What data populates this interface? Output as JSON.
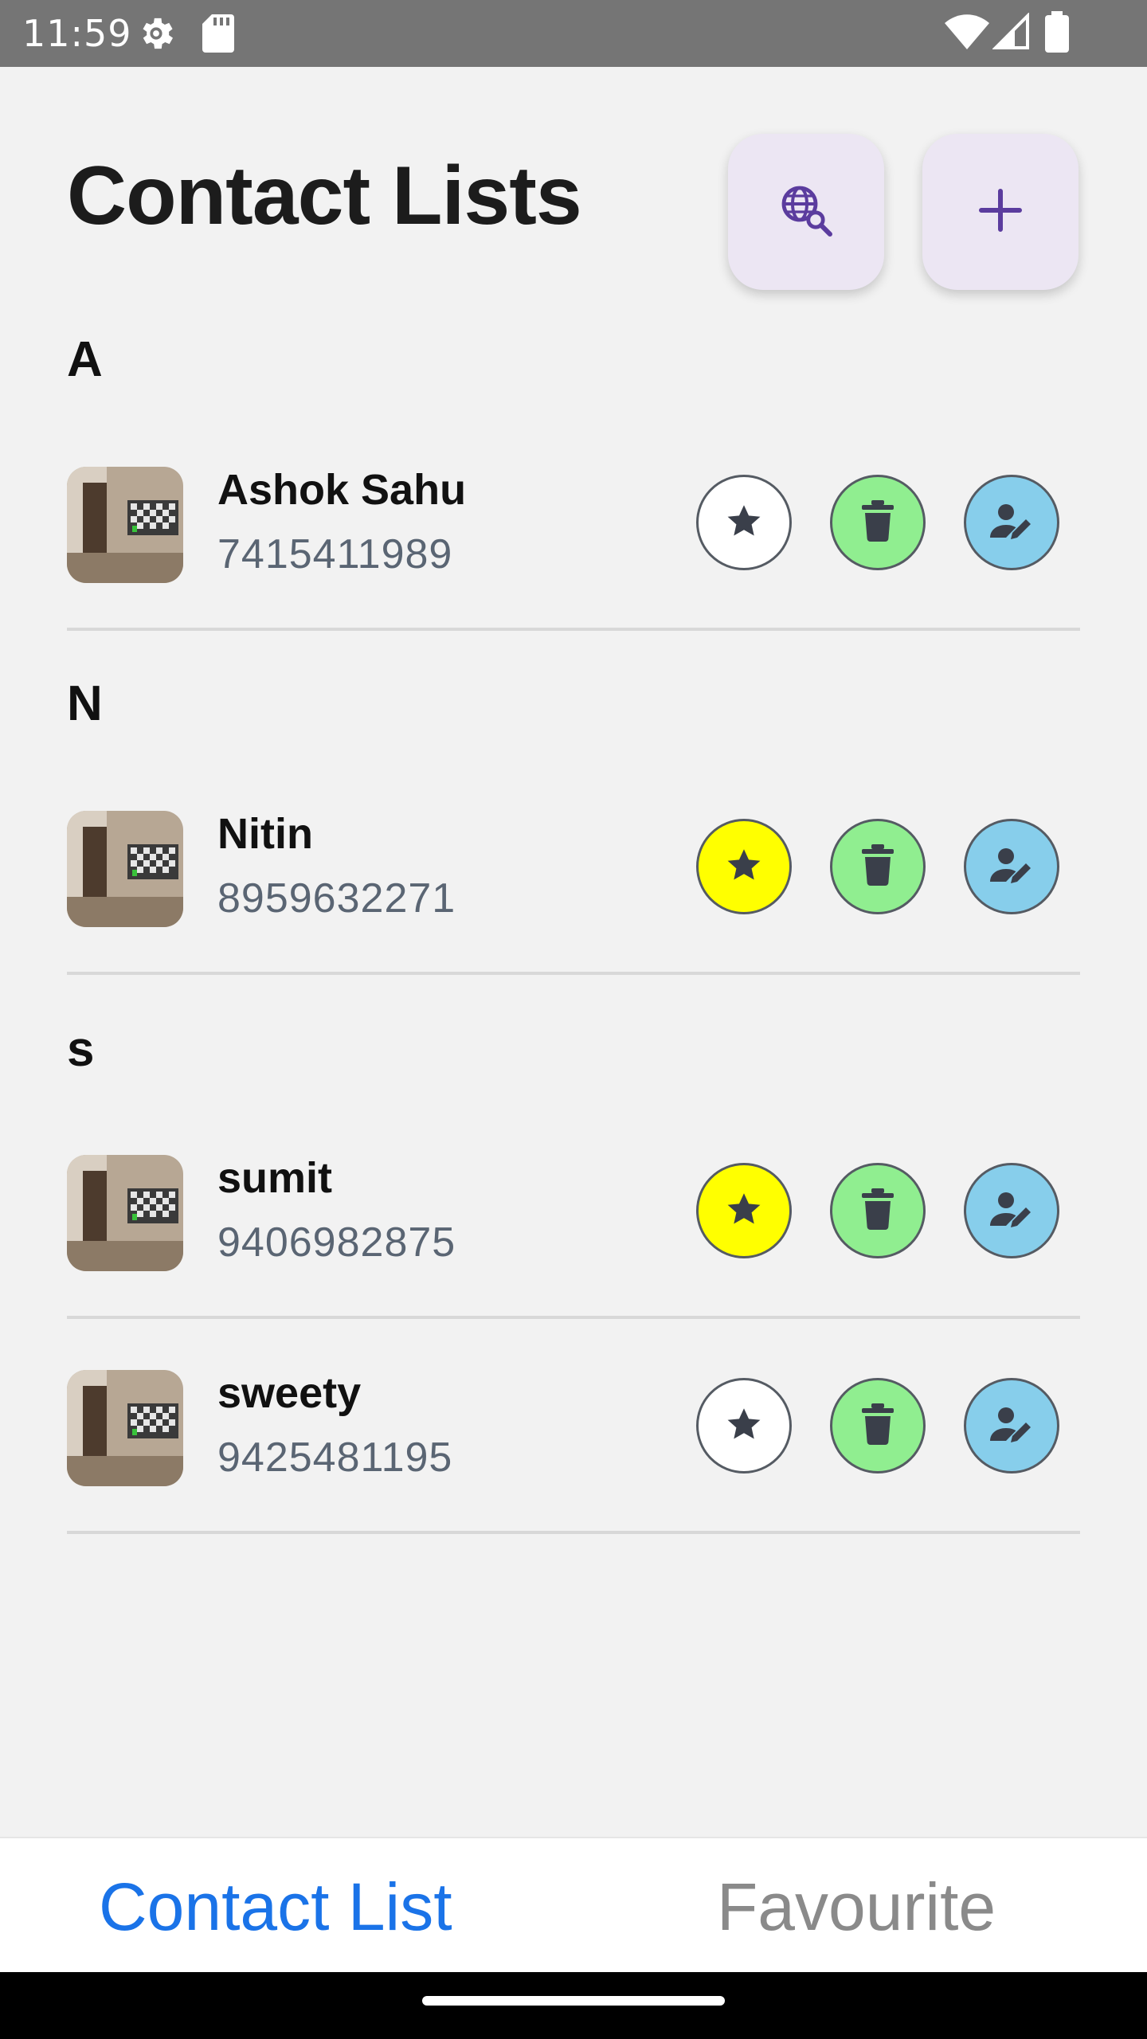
{
  "status_bar": {
    "time": "11:59"
  },
  "header": {
    "title": "Contact Lists"
  },
  "colors": {
    "fab_icon": "#5b3c9e",
    "star_active": "#ffff00",
    "star_inactive": "#ffffff",
    "delete_bg": "#90ee90",
    "edit_bg": "#87ceeb",
    "tab_active": "#1a73e8",
    "tab_inactive": "#8a8a8a"
  },
  "sections": [
    {
      "letter": "A",
      "contacts": [
        {
          "name": "Ashok Sahu",
          "phone": "7415411989",
          "favourite": false
        }
      ]
    },
    {
      "letter": "N",
      "contacts": [
        {
          "name": "Nitin",
          "phone": "8959632271",
          "favourite": true
        }
      ]
    },
    {
      "letter": "s",
      "contacts": [
        {
          "name": "sumit",
          "phone": "9406982875",
          "favourite": true
        },
        {
          "name": "sweety",
          "phone": "9425481195",
          "favourite": false
        }
      ]
    }
  ],
  "bottom_nav": {
    "tabs": [
      {
        "label": "Contact List",
        "active": true
      },
      {
        "label": "Favourite",
        "active": false
      }
    ]
  }
}
